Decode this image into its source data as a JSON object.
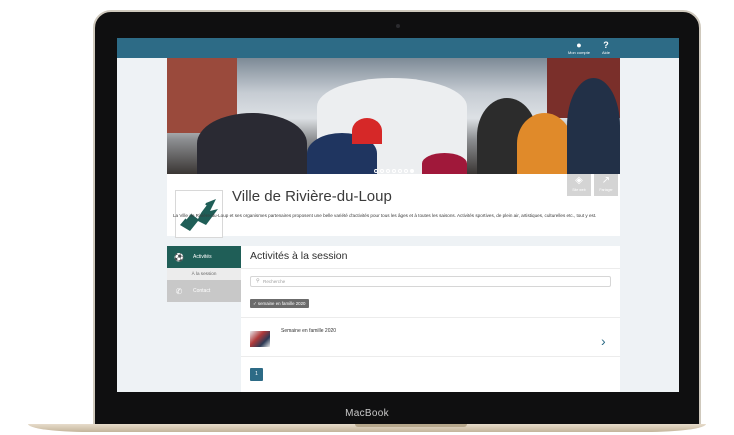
{
  "device": {
    "label": "MacBook"
  },
  "topbar": {
    "account": {
      "icon": "user-icon",
      "label": "Mon compte"
    },
    "help": {
      "icon": "help-icon",
      "label": "Aide"
    }
  },
  "header": {
    "title": "Ville de Rivière-du-Loup",
    "description": "La Ville de Rivière-du-Loup et ses organismes partenaires proposent une belle variété d'activités pour tous les âges et à toutes les saisons. Activités sportives, de plein air, artistiques, culturelles etc., tout y est.",
    "buttons": [
      {
        "icon": "globe-icon",
        "label": "Site web"
      },
      {
        "icon": "share-icon",
        "label": "Partager"
      }
    ]
  },
  "carousel": {
    "slide_count": 7,
    "active_index": 6
  },
  "sidebar": {
    "items": [
      {
        "icon": "activities-icon",
        "label": "Activités"
      },
      {
        "label": "À la session"
      },
      {
        "icon": "phone-icon",
        "label": "Contact"
      }
    ]
  },
  "main": {
    "title": "Activités à la session",
    "search": {
      "placeholder": "Recherche"
    },
    "filter_tag": "✓ semaine en famille 2020",
    "activities": [
      {
        "name": "Semaine en famille 2020"
      }
    ],
    "pagination": {
      "current_page": "1"
    }
  },
  "colors": {
    "brand": "#2d6b86",
    "sidebar_active": "#1f5e57"
  }
}
